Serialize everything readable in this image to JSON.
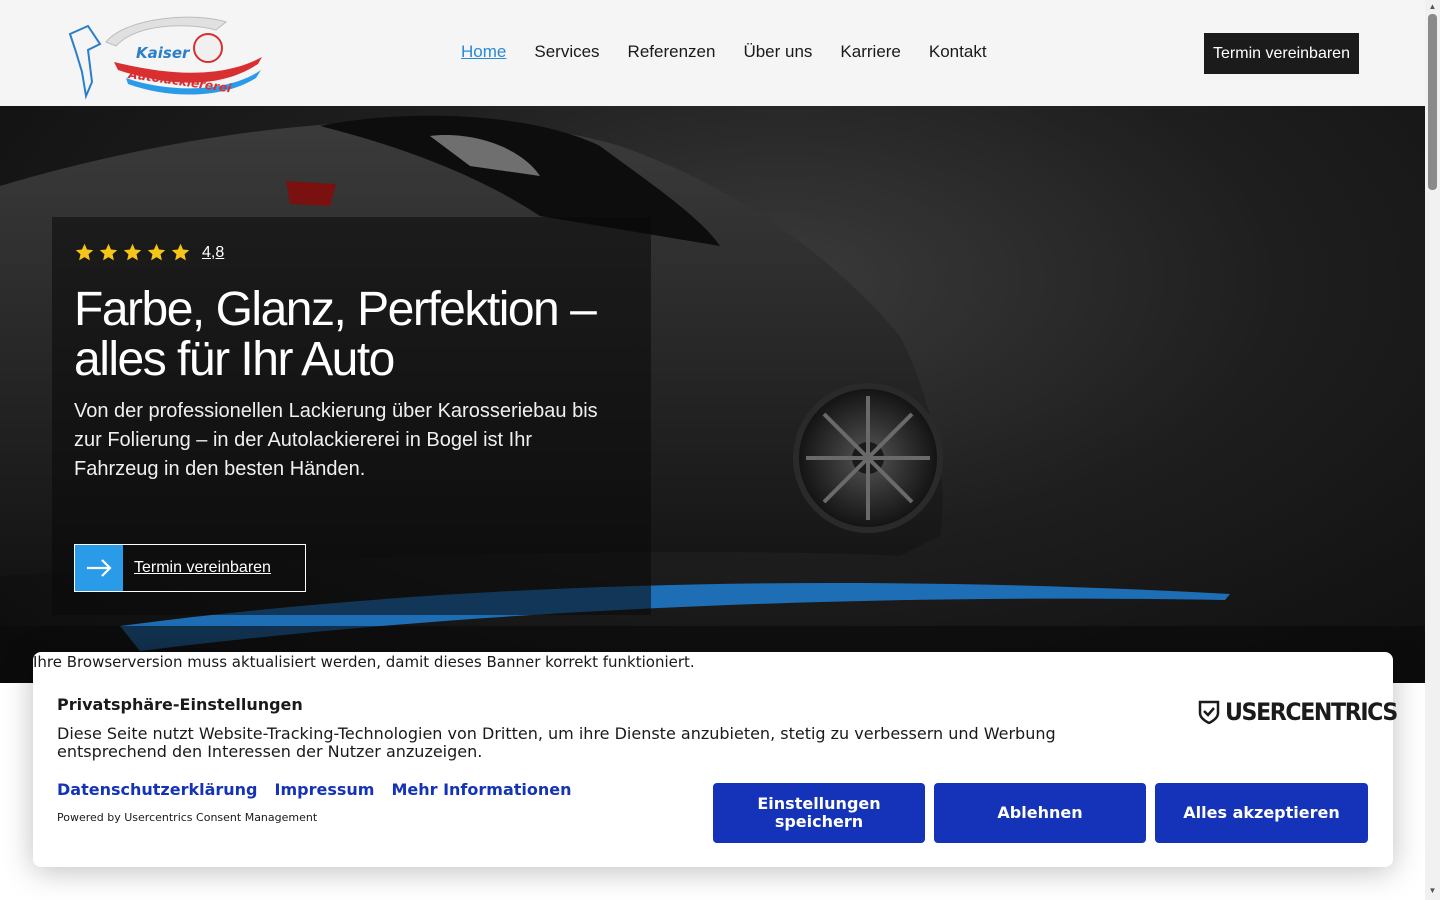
{
  "header": {
    "logo_text_top": "Kaiser",
    "logo_text_bottom": "Autolackiererei",
    "nav": [
      {
        "label": "Home",
        "active": true
      },
      {
        "label": "Services",
        "active": false
      },
      {
        "label": "Referenzen",
        "active": false
      },
      {
        "label": "Über uns",
        "active": false
      },
      {
        "label": "Karriere",
        "active": false
      },
      {
        "label": "Kontakt",
        "active": false
      }
    ],
    "cta_label": "Termin vereinbaren"
  },
  "hero": {
    "rating_stars": 5,
    "rating_value": "4,8",
    "title": "Farbe, Glanz, Perfektion – alles für Ihr Auto",
    "text": "Von der professionellen Lackierung über Karosseriebau bis zur Folierung – in der Autolackiererei in Bogel ist Ihr Fahrzeug in den besten Händen.",
    "cta_label": "Termin vereinbaren",
    "cta_icon": "arrow-right-icon"
  },
  "consent": {
    "browser_warning": "Ihre Browserversion muss aktualisiert werden, damit dieses Banner korrekt funktioniert.",
    "title": "Privatsphäre-Einstellungen",
    "brand": "USERCENTRICS",
    "description": "Diese Seite nutzt Website-Tracking-Technologien von Dritten, um ihre Dienste anzubieten, stetig zu verbessern und Werbung entsprechend den Interessen der Nutzer anzuzeigen.",
    "links": [
      "Datenschutzerklärung",
      "Impressum",
      "Mehr Informationen"
    ],
    "powered_by": "Powered by Usercentrics Consent Management",
    "buttons": {
      "save": "Einstellungen speichern",
      "deny": "Ablehnen",
      "accept": "Alles akzeptieren"
    }
  },
  "colors": {
    "nav_active": "#2b8ad6",
    "header_cta_bg": "#1b1b1b",
    "hero_accent": "#2a9be8",
    "consent_primary": "#1433b8",
    "star": "#f5c518"
  }
}
